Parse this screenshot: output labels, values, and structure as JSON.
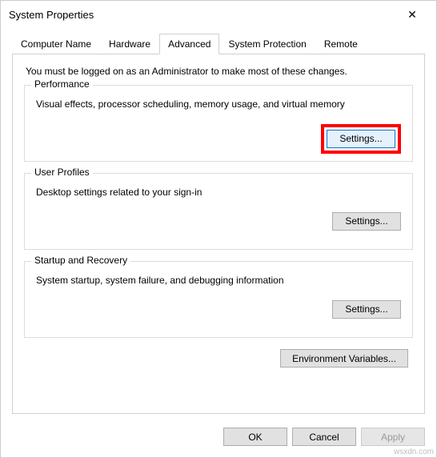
{
  "window": {
    "title": "System Properties",
    "close": "✕"
  },
  "tabs": {
    "computer_name": "Computer Name",
    "hardware": "Hardware",
    "advanced": "Advanced",
    "system_protection": "System Protection",
    "remote": "Remote"
  },
  "content": {
    "admin_note": "You must be logged on as an Administrator to make most of these changes.",
    "performance": {
      "legend": "Performance",
      "desc": "Visual effects, processor scheduling, memory usage, and virtual memory",
      "settings_label": "Settings..."
    },
    "user_profiles": {
      "legend": "User Profiles",
      "desc": "Desktop settings related to your sign-in",
      "settings_label": "Settings..."
    },
    "startup": {
      "legend": "Startup and Recovery",
      "desc": "System startup, system failure, and debugging information",
      "settings_label": "Settings..."
    },
    "env_vars_label": "Environment Variables..."
  },
  "footer": {
    "ok": "OK",
    "cancel": "Cancel",
    "apply": "Apply"
  },
  "watermark": "wsxdn.com"
}
